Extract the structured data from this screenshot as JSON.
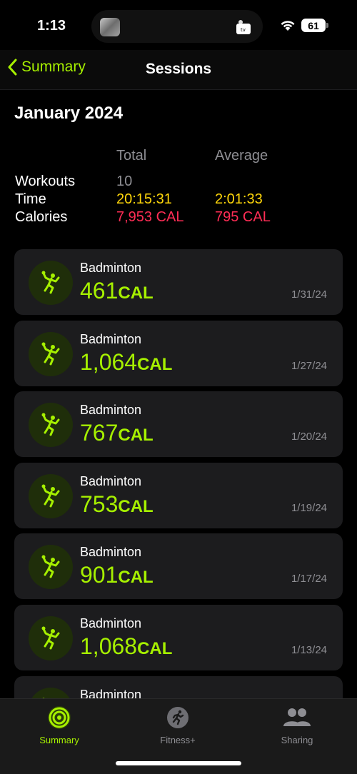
{
  "status_bar": {
    "time": "1:13",
    "battery": "61"
  },
  "nav": {
    "back_label": "Summary",
    "title": "Sessions"
  },
  "summary": {
    "month": "January 2024",
    "col_total": "Total",
    "col_average": "Average",
    "rows": [
      {
        "label": "Workouts",
        "total": "10",
        "average": ""
      },
      {
        "label": "Time",
        "total": "20:15:31",
        "average": "2:01:33"
      },
      {
        "label": "Calories",
        "total": "7,953 CAL",
        "average": "795 CAL"
      }
    ]
  },
  "sessions": [
    {
      "name": "Badminton",
      "calories": "461",
      "unit": "CAL",
      "date": "1/31/24"
    },
    {
      "name": "Badminton",
      "calories": "1,064",
      "unit": "CAL",
      "date": "1/27/24"
    },
    {
      "name": "Badminton",
      "calories": "767",
      "unit": "CAL",
      "date": "1/20/24"
    },
    {
      "name": "Badminton",
      "calories": "753",
      "unit": "CAL",
      "date": "1/19/24"
    },
    {
      "name": "Badminton",
      "calories": "901",
      "unit": "CAL",
      "date": "1/17/24"
    },
    {
      "name": "Badminton",
      "calories": "1,068",
      "unit": "CAL",
      "date": "1/13/24"
    },
    {
      "name": "Badminton",
      "calories": "",
      "unit": "",
      "date": ""
    }
  ],
  "tabs": [
    {
      "label": "Summary",
      "icon": "activity-rings-icon",
      "active": true
    },
    {
      "label": "Fitness+",
      "icon": "runner-icon",
      "active": false
    },
    {
      "label": "Sharing",
      "icon": "people-icon",
      "active": false
    }
  ],
  "colors": {
    "accent": "#a6f000",
    "yellow": "#ffd60a",
    "red": "#ff2d55",
    "card": "#1c1c1e"
  }
}
